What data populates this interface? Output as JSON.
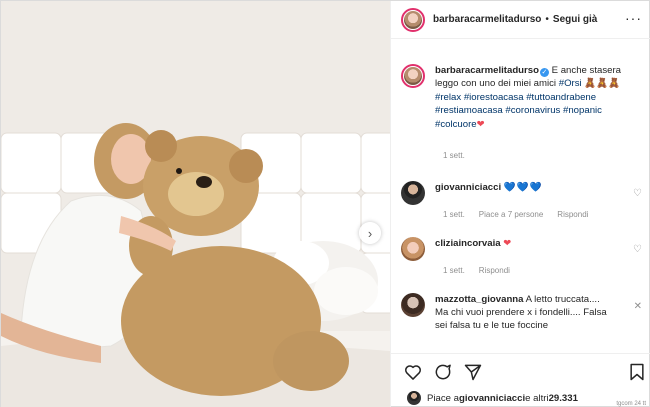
{
  "post": {
    "username": "barbaracarmelitadurso",
    "follow_label": "Segui già",
    "more_label": "···"
  },
  "caption": {
    "username": "barbaracarmelitadurso",
    "text": "E anche stasera leggo con uno dei miei amici",
    "hashtags": [
      "#Orsi",
      "#relax",
      "#iorestoacasa",
      "#tuttoandrabene",
      "#restiamoacasa",
      "#coronavirus",
      "#nopanic",
      "#colcuore"
    ],
    "bear_emoji": "🧸🧸🧸",
    "heart": "❤",
    "time": "1 sett."
  },
  "comments": [
    {
      "username": "giovanniciacci",
      "text": "💙💙💙",
      "time": "1 sett.",
      "likes": "Piace a 7 persone",
      "reply": "Rispondi"
    },
    {
      "username": "cliziaincorvaia",
      "text": "❤",
      "time": "1 sett.",
      "reply": "Rispondi"
    },
    {
      "username": "mazzotta_giovanna",
      "text": "A letto truccata.... Ma chi vuoi prendere x i fondelli.... Falsa sei falsa tu e le tue foccine"
    }
  ],
  "likes": {
    "prefix": "Piace a ",
    "user": "giovanniciacci",
    "middle": " e altri ",
    "count": "29.331"
  },
  "corner_text": "tgcom 24 tt",
  "colors": {
    "verified": "#3897f0",
    "heart": "#ed4956",
    "hashtag": "#003569",
    "muted": "#8e8e8e"
  },
  "icons": [
    "heart-icon",
    "comment-icon",
    "share-icon",
    "bookmark-icon",
    "chevron-right-icon",
    "verified-icon",
    "close-icon"
  ]
}
